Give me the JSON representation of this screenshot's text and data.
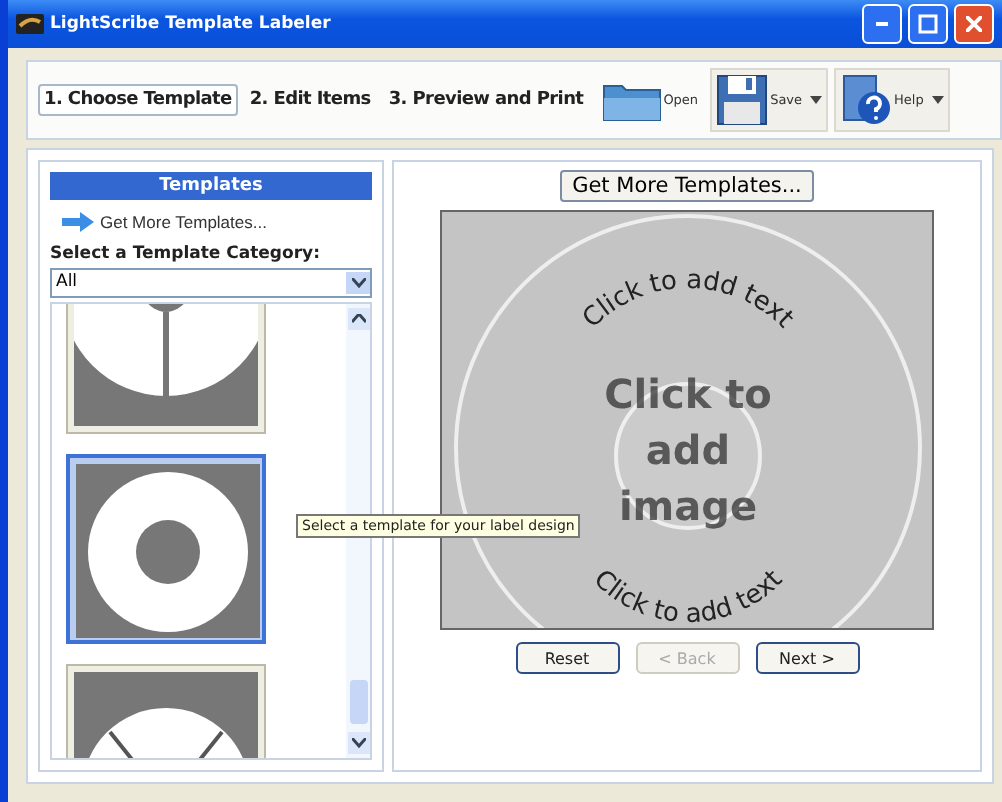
{
  "window": {
    "title": "LightScribe Template Labeler"
  },
  "steps": [
    {
      "label": "1. Choose Template",
      "selected": true
    },
    {
      "label": "2. Edit Items",
      "selected": false
    },
    {
      "label": "3. Preview and Print",
      "selected": false
    }
  ],
  "toolbar": [
    {
      "kind": "open",
      "label": "Open",
      "dropdown": false
    },
    {
      "kind": "save",
      "label": "Save",
      "dropdown": true
    },
    {
      "kind": "help",
      "label": "Help",
      "dropdown": true
    }
  ],
  "templates_panel": {
    "heading": "Templates",
    "link": "Get More Templates...",
    "category_label": "Select a Template Category:",
    "category": "All",
    "templates": [
      {
        "kind": "split",
        "selected": false
      },
      {
        "kind": "ring",
        "selected": true
      },
      {
        "kind": "spokes",
        "selected": false
      }
    ],
    "tooltip": "Select a template for your label design"
  },
  "preview": {
    "button": "Get More Templates...",
    "top_text": "Click to add text",
    "image_text": [
      "Click to",
      "add",
      "image"
    ],
    "bottom_text": "Click to add text"
  },
  "buttons": [
    {
      "label": "Reset",
      "disabled": false
    },
    {
      "label": "< Back",
      "disabled": true
    },
    {
      "label": "Next >",
      "disabled": false
    }
  ]
}
